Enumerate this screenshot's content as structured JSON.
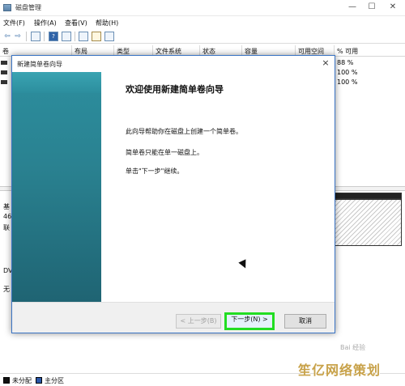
{
  "window": {
    "title": "磁盘管理",
    "minimize": "—",
    "maximize": "☐",
    "close": "✕"
  },
  "menu": [
    "文件(F)",
    "操作(A)",
    "查看(V)",
    "帮助(H)"
  ],
  "toolbar": {
    "back": "⇦",
    "forward": "⇨",
    "help_glyph": "?"
  },
  "volume_table": {
    "headers": [
      "卷",
      "布局",
      "类型",
      "文件系统",
      "状态",
      "容量",
      "可用空间",
      "% 可用"
    ],
    "rows": [
      {
        "pct": "88 %"
      },
      {
        "pct": "100 %"
      },
      {
        "pct": "100 %"
      }
    ]
  },
  "disks": {
    "disk0_labels": [
      "基",
      "46",
      "联"
    ],
    "cdrom_label": "DV",
    "nomedia_label": "无"
  },
  "legend": [
    {
      "label": "未分配",
      "color": "#111111"
    },
    {
      "label": "主分区",
      "color": "#2b57a8"
    }
  ],
  "dialog": {
    "title": "新建简单卷向导",
    "close": "×",
    "heading": "欢迎使用新建简单卷向导",
    "paragraphs": [
      "此向导帮助你在磁盘上创建一个简单卷。",
      "简单卷只能在单一磁盘上。",
      "单击\"下一步\"继续。"
    ],
    "buttons": {
      "back": "< 上一步(B)",
      "next": "下一步(N) >",
      "cancel": "取消"
    },
    "accent": "#3a74c4",
    "highlight": "#22dd22"
  },
  "watermark": {
    "main": "笙亿网络策划",
    "sub": "Bai 经验"
  }
}
